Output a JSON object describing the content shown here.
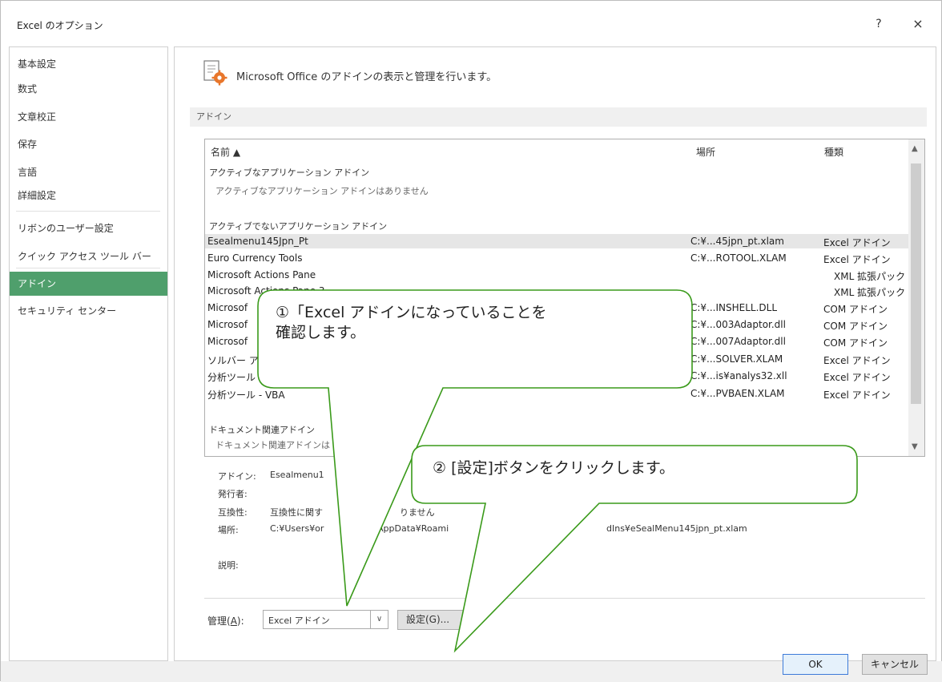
{
  "window": {
    "title": "Excel のオプション",
    "help_label": "?",
    "close_label": "×"
  },
  "sidebar": {
    "items": [
      {
        "label": "基本設定"
      },
      {
        "label": "数式"
      },
      {
        "label": "文章校正"
      },
      {
        "label": "保存"
      },
      {
        "label": "言語"
      },
      {
        "label": "詳細設定"
      },
      {
        "label": "リボンのユーザー設定"
      },
      {
        "label": "クイック アクセス ツール バー"
      },
      {
        "label": "アドイン"
      },
      {
        "label": "セキュリティ センター"
      }
    ],
    "active_index": 8
  },
  "main": {
    "header": "Microsoft Office のアドインの表示と管理を行います。",
    "section": "アドイン",
    "columns": {
      "name": "名前 ▲",
      "location": "場所",
      "type": "種類"
    },
    "groups": {
      "active_title": "アクティブなアプリケーション アドイン",
      "active_empty": "アクティブなアプリケーション アドインはありません",
      "inactive_title": "アクティブでないアプリケーション アドイン",
      "document_title": "ドキュメント関連アドイン",
      "document_sub": "ドキュメント関連アドインは"
    },
    "rows": [
      {
        "name": "Esealmenu145Jpn_Pt",
        "location": "C:¥...45jpn_pt.xlam",
        "type": "Excel アドイン"
      },
      {
        "name": "Euro Currency Tools",
        "location": "C:¥...ROTOOL.XLAM",
        "type": "Excel アドイン"
      },
      {
        "name": "Microsoft Actions Pane",
        "location": "",
        "type": "XML 拡張パック"
      },
      {
        "name": "Microsoft Actions Pane 3",
        "location": "",
        "type": "XML 拡張パック"
      },
      {
        "name": "Microsof",
        "location": "C:¥...INSHELL.DLL",
        "type": "COM アドイン"
      },
      {
        "name": "Microsof",
        "location": "C:¥...003Adaptor.dll",
        "type": "COM アドイン"
      },
      {
        "name": "Microsof",
        "location": "C:¥...007Adaptor.dll",
        "type": "COM アドイン"
      },
      {
        "name": "ソルバー ア",
        "location": "C:¥...SOLVER.XLAM",
        "type": "Excel アドイン"
      },
      {
        "name": "分析ツール",
        "location": "C:¥...is¥analys32.xll",
        "type": "Excel アドイン"
      },
      {
        "name": "分析ツール - VBA",
        "location": "C:¥...PVBAEN.XLAM",
        "type": "Excel アドイン"
      }
    ],
    "selected_index": 0,
    "details": {
      "addin_label": "アドイン:",
      "addin_value": "Esealmenu1",
      "publisher_label": "発行者:",
      "compat_label": "互換性:",
      "compat_value_a": "互換性に関す",
      "compat_value_b": "りません",
      "location_label": "場所:",
      "location_value_a": "C:¥Users¥or",
      "location_value_b": "AppData¥Roami",
      "location_value_c": "dIns¥eSealMenu145jpn_pt.xlam",
      "desc_label": "説明:"
    },
    "manage": {
      "label": "管理(",
      "label_key": "A",
      "label_end": "):",
      "selected": "Excel アドイン",
      "go_label": "設定(G)..."
    }
  },
  "footer": {
    "ok": "OK",
    "cancel": "キャンセル"
  },
  "callouts": [
    {
      "text": "①「Excel アドインになっていることを\n確認します。"
    },
    {
      "text": "② [設定]ボタンをクリックします。"
    }
  ],
  "colors": {
    "accent": "#4f9f6c",
    "callout_border": "#3a9a1a"
  }
}
